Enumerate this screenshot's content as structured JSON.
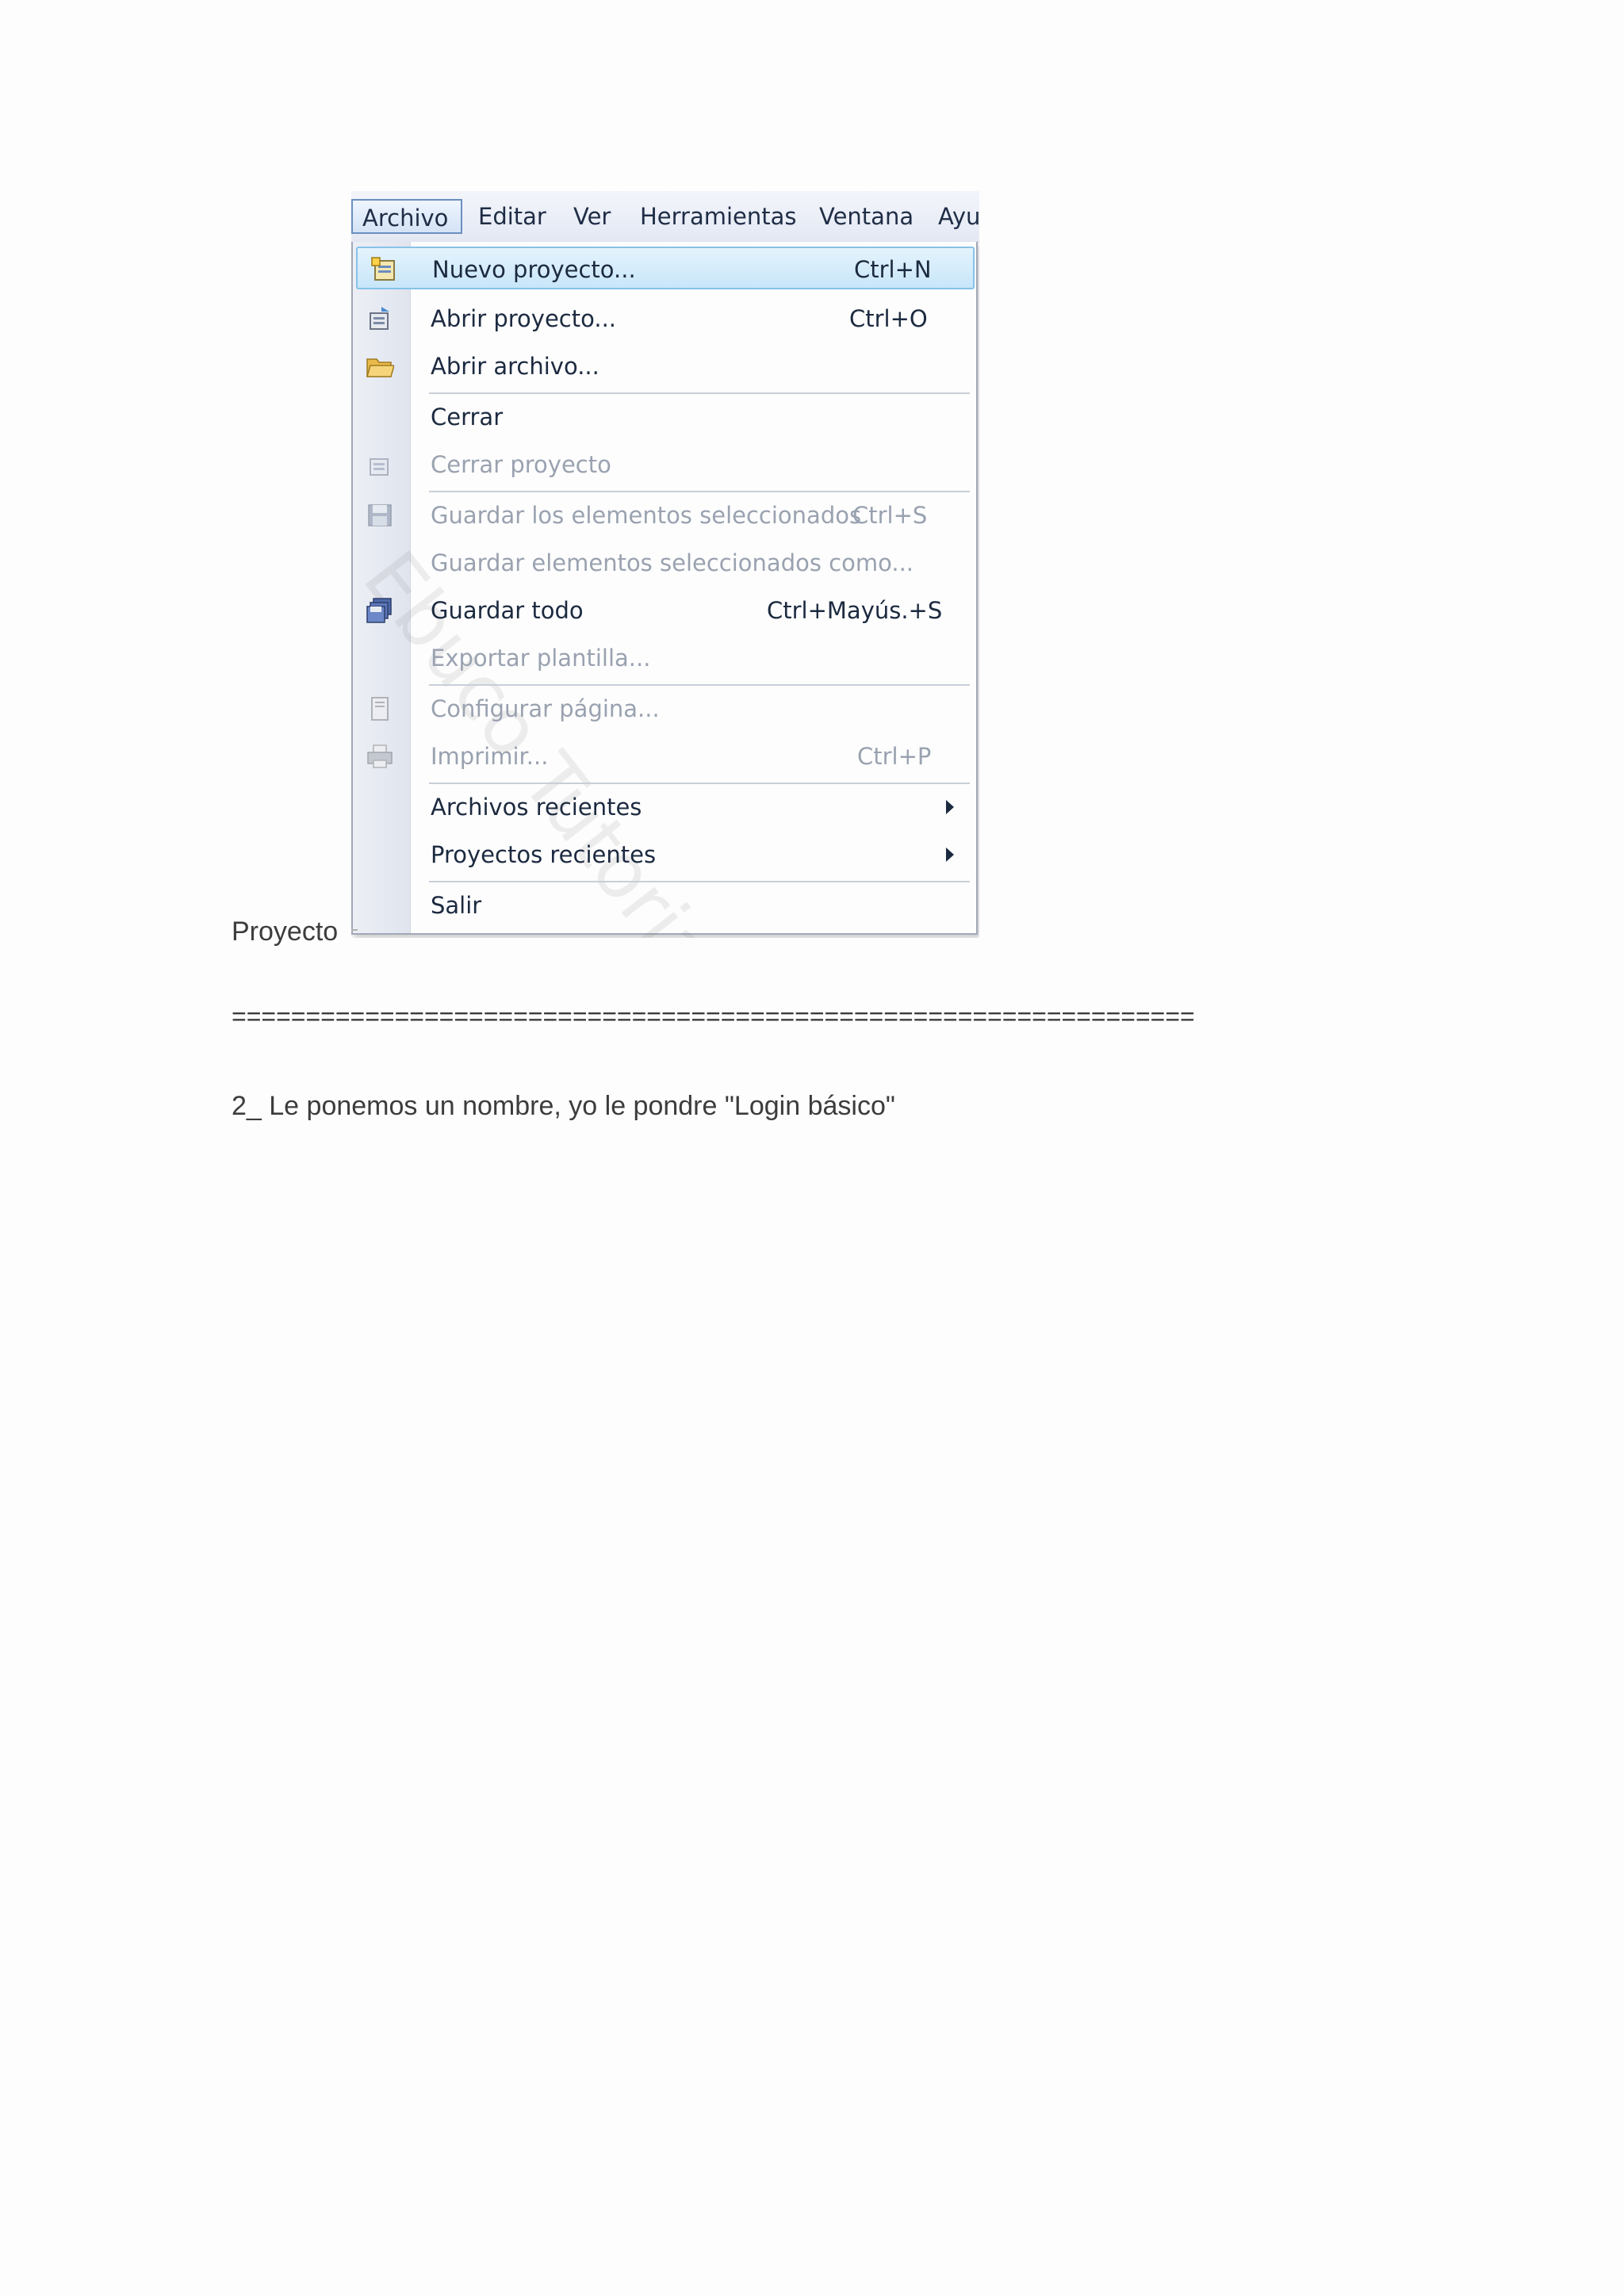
{
  "screenshot": {
    "menubar": {
      "items": [
        {
          "label": "Archivo",
          "active": true
        },
        {
          "label": "Editar"
        },
        {
          "label": "Ver"
        },
        {
          "label": "Herramientas"
        },
        {
          "label": "Ventana"
        },
        {
          "label": "Ayu"
        }
      ]
    },
    "menu": {
      "items": [
        {
          "label": "Nuevo proyecto...",
          "shortcut": "Ctrl+N",
          "icon": "new-project-icon",
          "state": "highlighted"
        },
        {
          "label": "Abrir proyecto...",
          "shortcut": "Ctrl+O",
          "icon": "open-project-icon",
          "state": "enabled"
        },
        {
          "label": "Abrir archivo...",
          "shortcut": "",
          "icon": "open-folder-icon",
          "state": "enabled"
        },
        {
          "label": "Cerrar",
          "shortcut": "",
          "icon": "",
          "state": "enabled"
        },
        {
          "label": "Cerrar proyecto",
          "shortcut": "",
          "icon": "close-project-icon",
          "state": "disabled"
        },
        {
          "label": "Guardar los elementos seleccionados",
          "shortcut": "Ctrl+S",
          "icon": "save-icon",
          "state": "disabled"
        },
        {
          "label": "Guardar elementos seleccionados como...",
          "shortcut": "",
          "icon": "",
          "state": "disabled"
        },
        {
          "label": "Guardar todo",
          "shortcut": "Ctrl+Mayús.+S",
          "icon": "save-all-icon",
          "state": "enabled"
        },
        {
          "label": "Exportar plantilla...",
          "shortcut": "",
          "icon": "",
          "state": "disabled"
        },
        {
          "label": "Configurar página...",
          "shortcut": "",
          "icon": "page-setup-icon",
          "state": "disabled"
        },
        {
          "label": "Imprimir...",
          "shortcut": "Ctrl+P",
          "icon": "print-icon",
          "state": "disabled"
        },
        {
          "label": "Archivos recientes",
          "shortcut": "",
          "icon": "",
          "state": "enabled",
          "submenu": true
        },
        {
          "label": "Proyectos recientes",
          "shortcut": "",
          "icon": "",
          "state": "enabled",
          "submenu": true
        },
        {
          "label": "Salir",
          "shortcut": "",
          "icon": "",
          "state": "enabled"
        }
      ]
    },
    "watermark": "Ebuco Tutoriales"
  },
  "document": {
    "proyecto_label": "Proyecto",
    "divider": "=================================================================",
    "step_text": "2_ Le ponemos un nombre, yo le pondre \"Login básico\""
  },
  "colors": {
    "highlight": "#c8e6f9",
    "menu_text": "#1c2a40",
    "disabled_text": "#9aa2b0",
    "doc_text": "#3c3c3c"
  }
}
